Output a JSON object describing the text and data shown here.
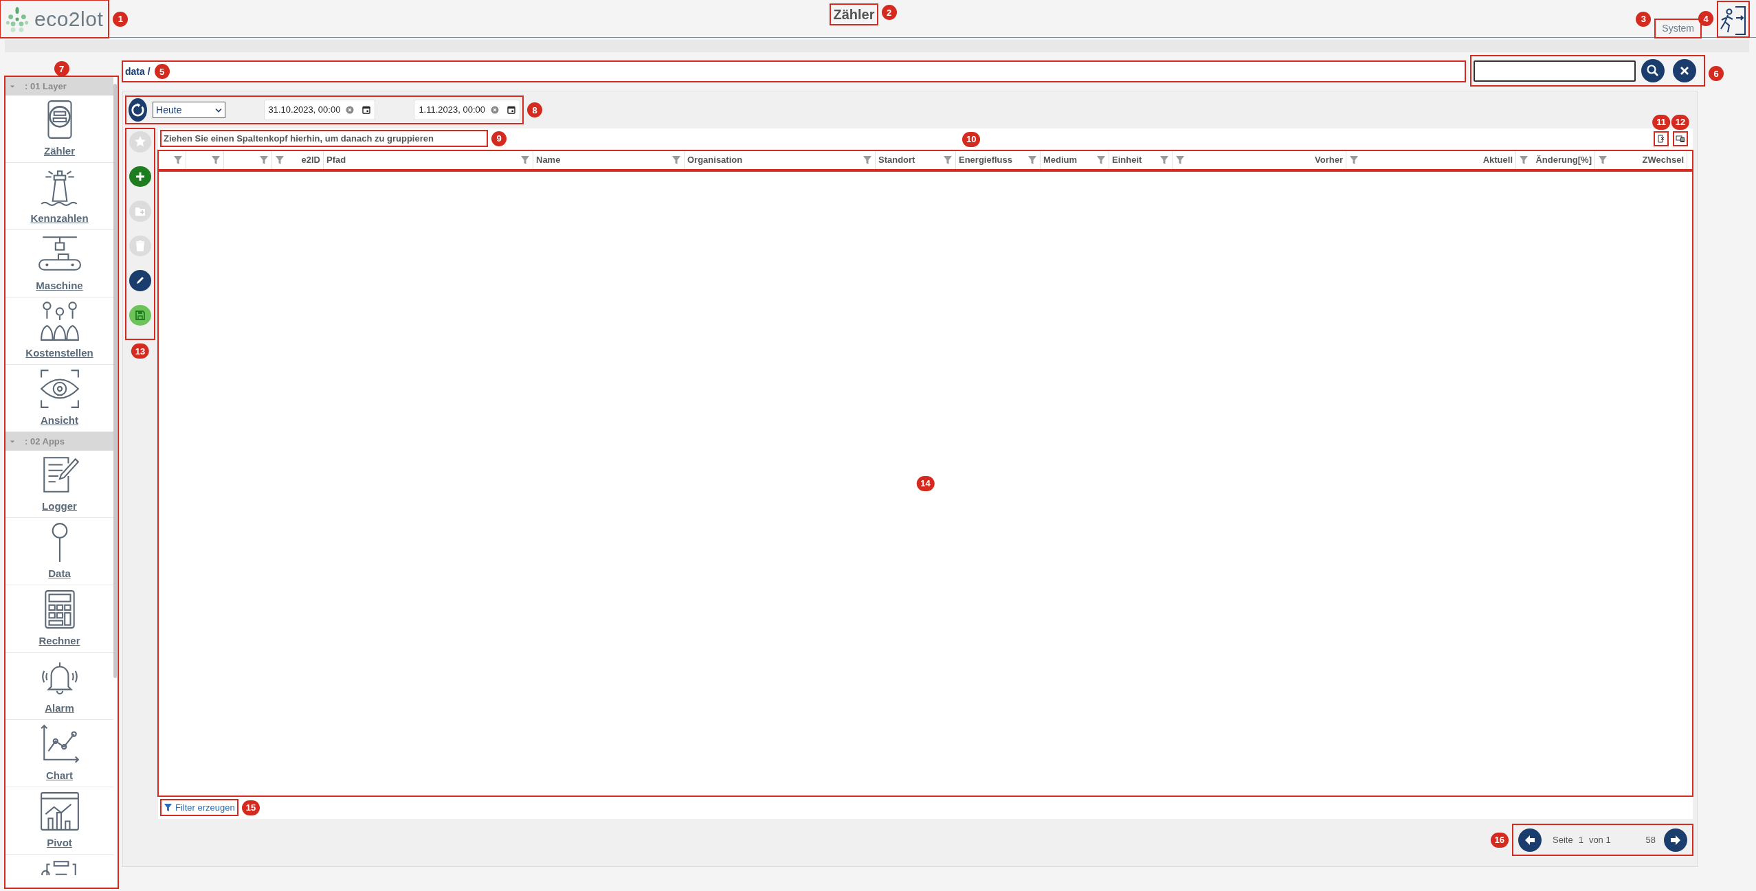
{
  "header": {
    "logo": {
      "text": "eco2lot",
      "callout": "1"
    },
    "title": {
      "text": "Zähler",
      "callout": "2"
    },
    "system_link": {
      "text": "System",
      "callout": "3"
    },
    "exit_button": {
      "callout": "4"
    }
  },
  "sidebar": {
    "callout": "7",
    "groups": [
      {
        "label": ": 01 Layer",
        "expanded": true,
        "items": [
          {
            "label": "Zähler"
          },
          {
            "label": "Kennzahlen"
          },
          {
            "label": "Maschine"
          },
          {
            "label": "Kostenstellen"
          },
          {
            "label": "Ansicht"
          }
        ]
      },
      {
        "label": ": 02 Apps",
        "expanded": true,
        "items": [
          {
            "label": "Logger"
          },
          {
            "label": "Data"
          },
          {
            "label": "Rechner"
          },
          {
            "label": "Alarm"
          },
          {
            "label": "Chart"
          },
          {
            "label": "Pivot"
          },
          {
            "cut_off": true
          }
        ]
      }
    ]
  },
  "breadcrumb": {
    "text": "data /",
    "callout": "5"
  },
  "search": {
    "callout": "6"
  },
  "toolbar": {
    "callout": "8",
    "period": {
      "value": "Heute"
    },
    "from": {
      "value": "31.10.2023, 00:00"
    },
    "to": {
      "value": "1.11.2023, 00:00"
    }
  },
  "actions": {
    "callout": "13",
    "items": [
      {
        "kind": "favorite",
        "disabled": true
      },
      {
        "kind": "add",
        "disabled": false
      },
      {
        "kind": "copy",
        "disabled": true
      },
      {
        "kind": "delete",
        "disabled": true
      },
      {
        "kind": "edit",
        "disabled": false
      },
      {
        "kind": "save",
        "disabled": false
      }
    ]
  },
  "grid": {
    "group_panel": {
      "text": "Ziehen Sie einen Spaltenkopf hierhin, um danach zu gruppieren",
      "callout": "9"
    },
    "export_excel": {
      "callout": "11"
    },
    "column_chooser": {
      "callout": "12"
    },
    "columns_callout": "10",
    "columns": [
      {
        "filter_first": false
      },
      {
        "filter_first": false
      },
      {
        "filter_first": false
      },
      {
        "label": "e2ID",
        "filter_first": true
      },
      {
        "label": "Pfad",
        "filter_first": false
      },
      {
        "label": "Name",
        "filter_first": false
      },
      {
        "label": "Organisation",
        "filter_first": false
      },
      {
        "label": "Standort",
        "filter_first": false
      },
      {
        "label": "Energiefluss",
        "filter_first": false
      },
      {
        "label": "Medium",
        "filter_first": false
      },
      {
        "label": "Einheit",
        "filter_first": false
      },
      {
        "label": "Vorher",
        "filter_first": true
      },
      {
        "label": "Aktuell",
        "filter_first": true
      },
      {
        "label": "Änderung[%]",
        "filter_first": true
      },
      {
        "label": "ZWechsel",
        "filter_first": true
      }
    ],
    "body_callout": "14",
    "filter_link": {
      "text": "Filter erzeugen",
      "callout": "15"
    }
  },
  "pager": {
    "callout": "16",
    "page_label": "Seite",
    "page": "1",
    "of": "von 1",
    "total": "58"
  }
}
